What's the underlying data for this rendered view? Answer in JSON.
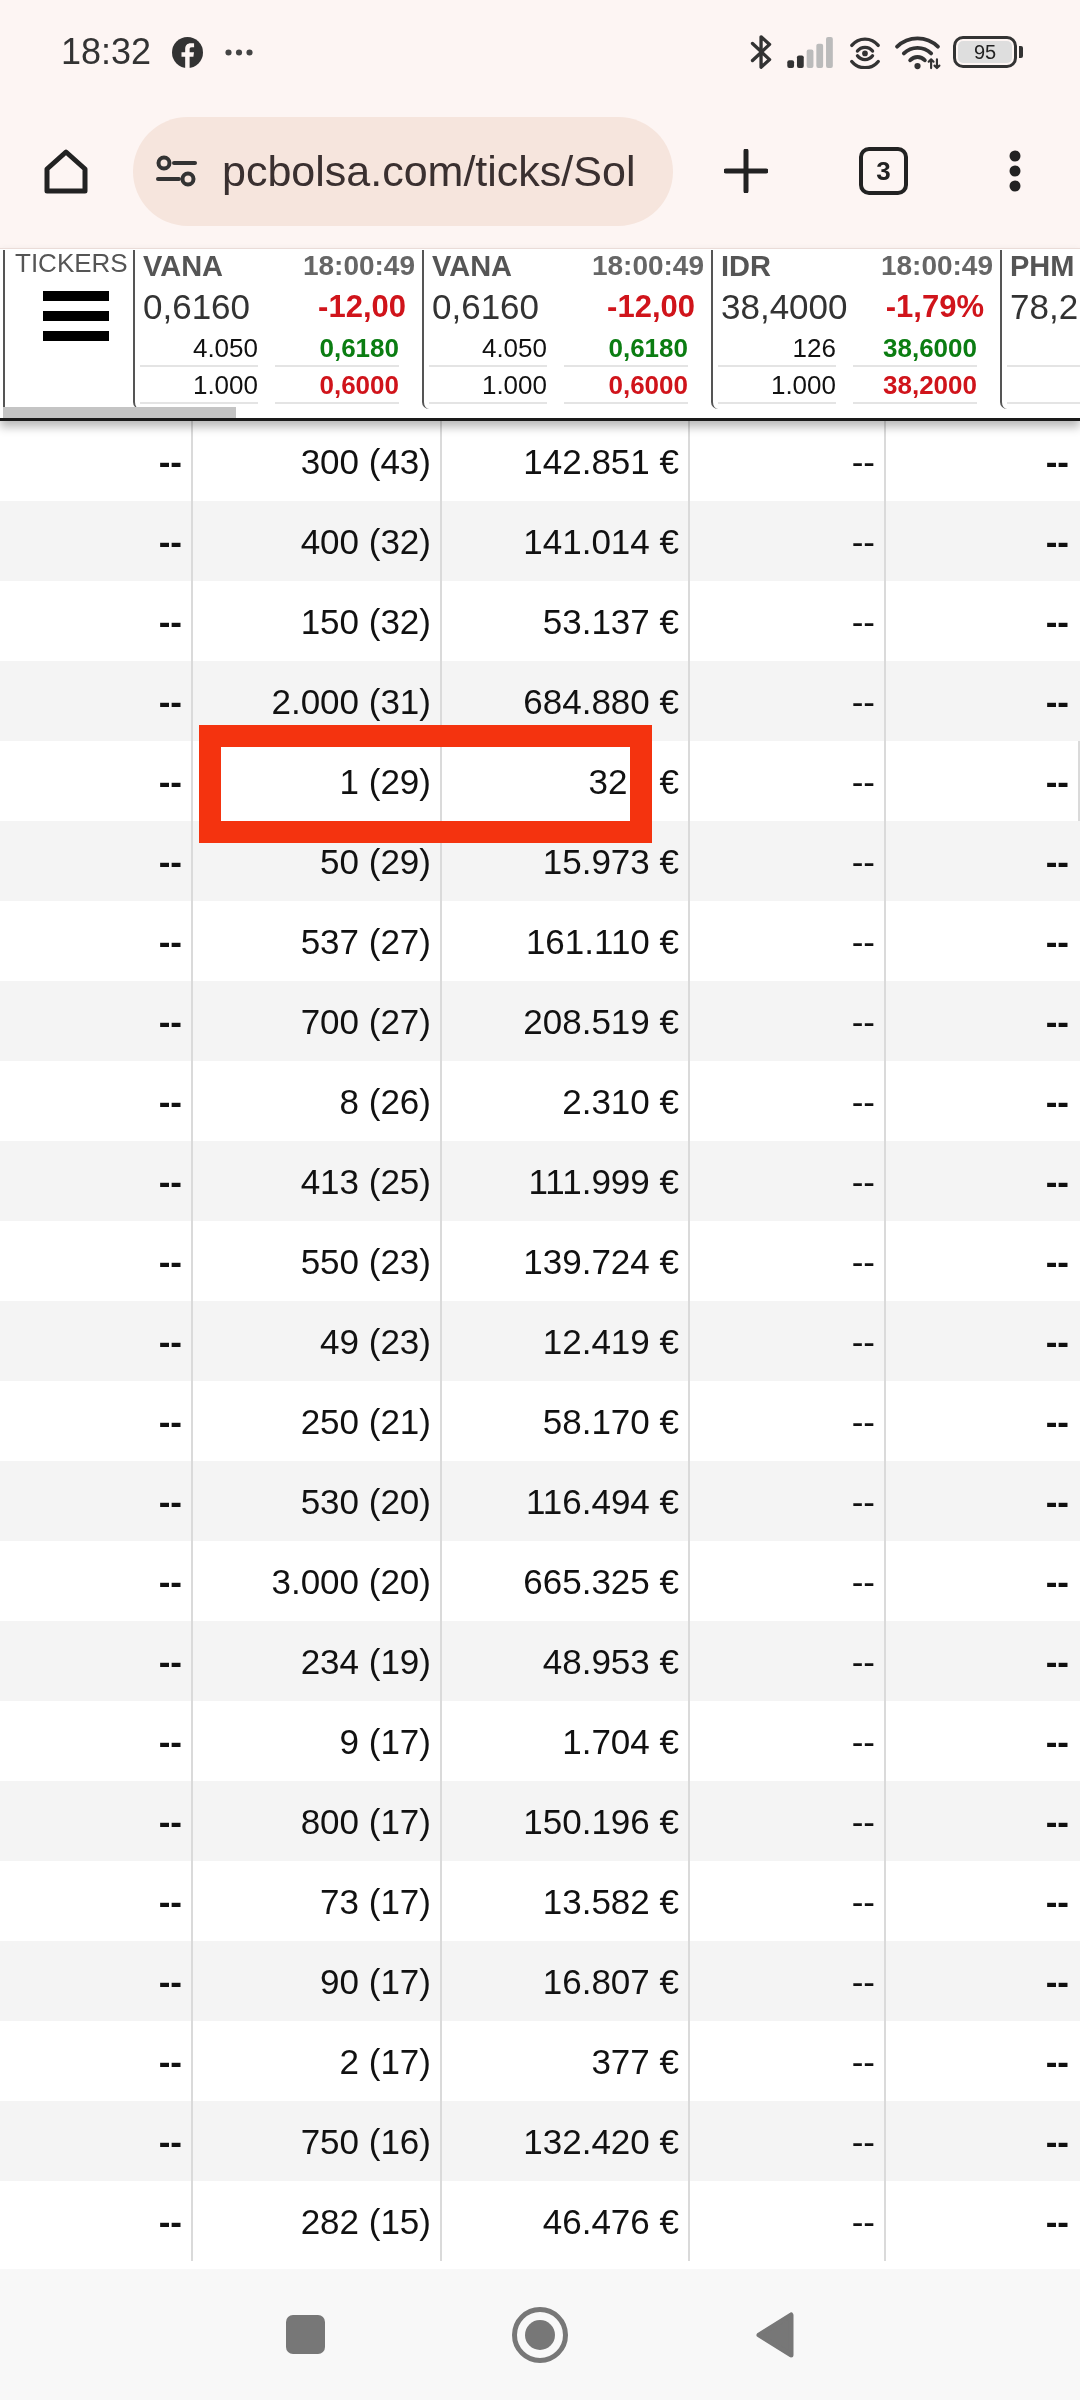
{
  "status_bar": {
    "time": "18:32",
    "battery": "95"
  },
  "browser_toolbar": {
    "url": "pcbolsa.com/ticks/Sol",
    "tab_count": "3"
  },
  "ticker_strip": {
    "label": "TICKERS",
    "tickers": [
      {
        "symbol": "VANA",
        "time": "18:00:49",
        "price": "0,6160",
        "change": "-12,00",
        "falling": true,
        "bid_size": "4.050",
        "bid": "0,6180",
        "ask_size": "1.000",
        "ask": "0,6000"
      },
      {
        "symbol": "VANA",
        "time": "18:00:49",
        "price": "0,6160",
        "change": "-12,00",
        "falling": true,
        "bid_size": "4.050",
        "bid": "0,6180",
        "ask_size": "1.000",
        "ask": "0,6000"
      },
      {
        "symbol": "IDR",
        "time": "18:00:49",
        "price": "38,4000",
        "change": "-1,79%",
        "falling": true,
        "bid_size": "126",
        "bid": "38,6000",
        "ask_size": "1.000",
        "ask": "38,2000"
      },
      {
        "symbol": "PHM",
        "price": "78,2"
      }
    ]
  },
  "table": {
    "rows": [
      {
        "cells": [
          "--",
          "300 (43)",
          "142.851 €",
          "--",
          "--"
        ],
        "highlighted": false
      },
      {
        "cells": [
          "--",
          "400 (32)",
          "141.014 €",
          "--",
          "--"
        ],
        "highlighted": false
      },
      {
        "cells": [
          "--",
          "150 (32)",
          "53.137 €",
          "--",
          "--"
        ],
        "highlighted": false
      },
      {
        "cells": [
          "--",
          "2.000 (31)",
          "684.880 €",
          "--",
          "--"
        ],
        "highlighted": false
      },
      {
        "cells": [
          "--",
          "1 (29)",
          [
            "32",
            "€"
          ],
          "--",
          "--"
        ],
        "highlighted": true
      },
      {
        "cells": [
          "--",
          "50 (29)",
          "15.973 €",
          "--",
          "--"
        ],
        "highlighted": false
      },
      {
        "cells": [
          "--",
          "537 (27)",
          "161.110 €",
          "--",
          "--"
        ],
        "highlighted": false
      },
      {
        "cells": [
          "--",
          "700 (27)",
          "208.519 €",
          "--",
          "--"
        ],
        "highlighted": false
      },
      {
        "cells": [
          "--",
          "8 (26)",
          "2.310 €",
          "--",
          "--"
        ],
        "highlighted": false
      },
      {
        "cells": [
          "--",
          "413 (25)",
          "111.999 €",
          "--",
          "--"
        ],
        "highlighted": false
      },
      {
        "cells": [
          "--",
          "550 (23)",
          "139.724 €",
          "--",
          "--"
        ],
        "highlighted": false
      },
      {
        "cells": [
          "--",
          "49 (23)",
          "12.419 €",
          "--",
          "--"
        ],
        "highlighted": false
      },
      {
        "cells": [
          "--",
          "250 (21)",
          "58.170 €",
          "--",
          "--"
        ],
        "highlighted": false
      },
      {
        "cells": [
          "--",
          "530 (20)",
          "116.494 €",
          "--",
          "--"
        ],
        "highlighted": false
      },
      {
        "cells": [
          "--",
          "3.000 (20)",
          "665.325 €",
          "--",
          "--"
        ],
        "highlighted": false
      },
      {
        "cells": [
          "--",
          "234 (19)",
          "48.953 €",
          "--",
          "--"
        ],
        "highlighted": false
      },
      {
        "cells": [
          "--",
          "9 (17)",
          "1.704 €",
          "--",
          "--"
        ],
        "highlighted": false
      },
      {
        "cells": [
          "--",
          "800 (17)",
          "150.196 €",
          "--",
          "--"
        ],
        "highlighted": false
      },
      {
        "cells": [
          "--",
          "73 (17)",
          "13.582 €",
          "--",
          "--"
        ],
        "highlighted": false
      },
      {
        "cells": [
          "--",
          "90 (17)",
          "16.807 €",
          "--",
          "--"
        ],
        "highlighted": false
      },
      {
        "cells": [
          "--",
          "2 (17)",
          "377 €",
          "--",
          "--"
        ],
        "highlighted": false
      },
      {
        "cells": [
          "--",
          "750 (16)",
          "132.420 €",
          "--",
          "--"
        ],
        "highlighted": false
      },
      {
        "cells": [
          "--",
          "282 (15)",
          "46.476 €",
          "--",
          "--"
        ],
        "highlighted": false
      }
    ]
  }
}
